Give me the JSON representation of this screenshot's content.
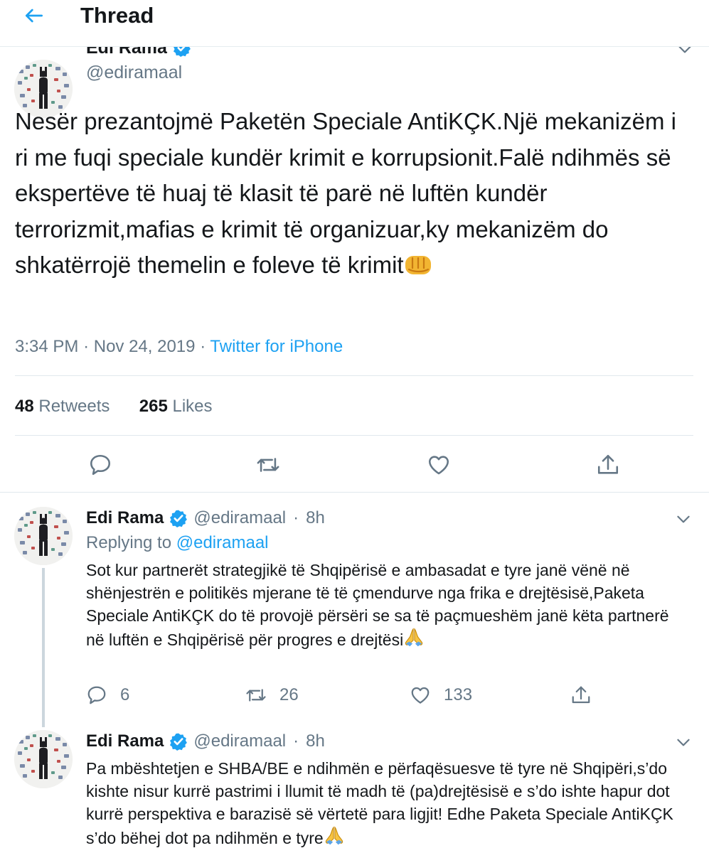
{
  "header": {
    "title": "Thread",
    "back_icon": "arrow-left-icon"
  },
  "colors": {
    "accent": "#1da1f2",
    "secondary_text": "#657786",
    "divider": "#e1e8ed"
  },
  "main_tweet": {
    "name": "Edi Rama",
    "handle": "@ediramaal",
    "text": "Nesër prezantojmë Paketën Speciale AntiKÇK.Një mekanizëm i ri me fuqi speciale kundër krimit e korrupsionit.Falë ndihmës së ekspertëve të huaj të klasit të parë në luftën kundër terrorizmit,mafias e krimit të organizuar,ky mekanizëm do shkatërrojë themelin e foleve të krimit",
    "emoji": "fist-icon",
    "time": "3:34 PM",
    "date": "Nov 24, 2019",
    "separator": "·",
    "source": "Twitter for iPhone",
    "retweets_count": "48",
    "retweets_label": "Retweets",
    "likes_count": "265",
    "likes_label": "Likes"
  },
  "replies": [
    {
      "name": "Edi Rama",
      "handle": "@ediramaal",
      "dot": "·",
      "time": "8h",
      "replying_prefix": "Replying to",
      "replying_to": "@ediramaal",
      "text": "Sot kur partnerët strategjikë të Shqipërisë e ambasadat e tyre janë vënë në shënjestrën e politikës mjerane të të çmendurve nga frika e drejtësisë,Paketa Speciale AntiKÇK do të provojë përsëri se sa të paçmueshëm janë këta partnerë në luftën e Shqipërisë për progres e drejtësi",
      "emoji": "folded-hands-icon",
      "replies_count": "6",
      "retweets_count": "26",
      "likes_count": "133"
    },
    {
      "name": "Edi Rama",
      "handle": "@ediramaal",
      "dot": "·",
      "time": "8h",
      "text": "Pa mbështetjen e SHBA/BE e ndihmën e përfaqësuesve të tyre në Shqipëri,s’do kishte nisur kurrë pastrimi i llumit të madh të (pa)drejtësisë e s’do ishte hapur dot kurrë perspektiva e barazisë së vërtetë para ligjit! Edhe Paketa Speciale AntiKÇK s’do bëhej dot pa ndihmën e tyre",
      "emoji": "folded-hands-icon"
    }
  ]
}
